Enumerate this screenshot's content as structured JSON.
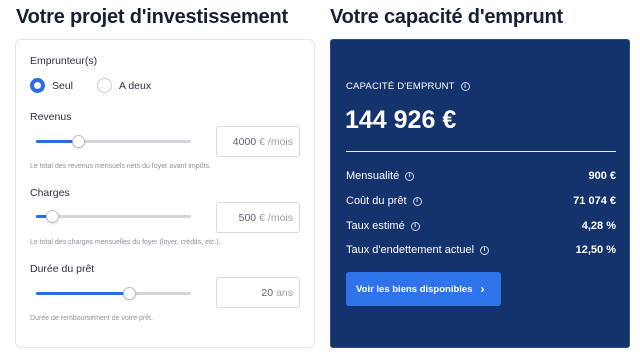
{
  "left": {
    "title": "Votre projet d'investissement",
    "borrowers": {
      "label": "Emprunteur(s)",
      "options": [
        "Seul",
        "A deux"
      ],
      "selected": "Seul"
    },
    "revenus": {
      "label": "Revenus",
      "value": "4000",
      "unit": "€ /mois",
      "hint": "Le total des revenus mensuels nets du foyer avant impôts."
    },
    "charges": {
      "label": "Charges",
      "value": "500",
      "unit": "€ /mois",
      "hint": "Le total des charges mensuelles du foyer (loyer, crédits, etc.)."
    },
    "duree": {
      "label": "Durée du prêt",
      "value": "20",
      "unit": "ans",
      "hint": "Durée de remboursement de votre prêt."
    }
  },
  "right": {
    "title": "Votre capacité d'emprunt",
    "cap_label": "CAPACITÉ D'EMPRUNT",
    "amount": "144 926 €",
    "rows": [
      {
        "label": "Mensualité",
        "value": "900 €"
      },
      {
        "label": "Coût du prêt",
        "value": "71 074 €"
      },
      {
        "label": "Taux estimé",
        "value": "4,28 %"
      },
      {
        "label": "Taux d'endettement actuel",
        "value": "12,50 %"
      }
    ],
    "cta": "Voir les biens disponibles"
  },
  "icons": {
    "info": "info-icon",
    "chevron": "chevron-right-icon"
  },
  "colors": {
    "accent": "#2d6ae8",
    "panel_bg": "#14326c",
    "cta": "#2f73ea"
  },
  "sliders": {
    "revenus_fraction": 0.27,
    "charges_fraction": 0.1,
    "duree_fraction": 0.6
  }
}
